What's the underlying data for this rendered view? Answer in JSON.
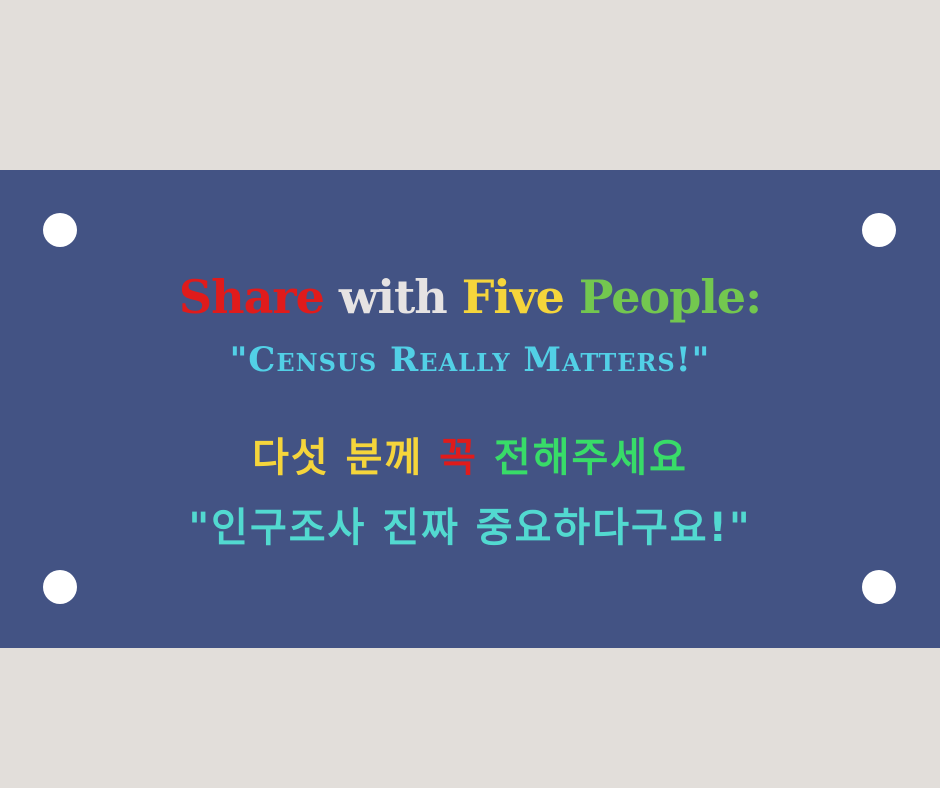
{
  "headline": {
    "word1": "Share",
    "word2": "with",
    "word3": "Five",
    "word4": "People:",
    "colors": {
      "word1": "#e01b1b",
      "word2": "#e6e3e3",
      "word3": "#f5d53b",
      "word4": "#73c74f"
    }
  },
  "subhead": {
    "text": "\"Census Really Matters!\"",
    "color": "#52d0e6"
  },
  "korean_line1": {
    "part1": "다섯 분께",
    "part2": "꼭",
    "part3": "전해주세요",
    "colors": {
      "part1": "#f5d53b",
      "part2": "#e01b1b",
      "part3": "#38dc68"
    }
  },
  "korean_line2": {
    "text": "\"인구조사 진짜 중요하다구요!\"",
    "color": "#52d9d0"
  },
  "colors": {
    "background": "#e2deda",
    "panel": "#435384",
    "holes": "#ffffff"
  }
}
